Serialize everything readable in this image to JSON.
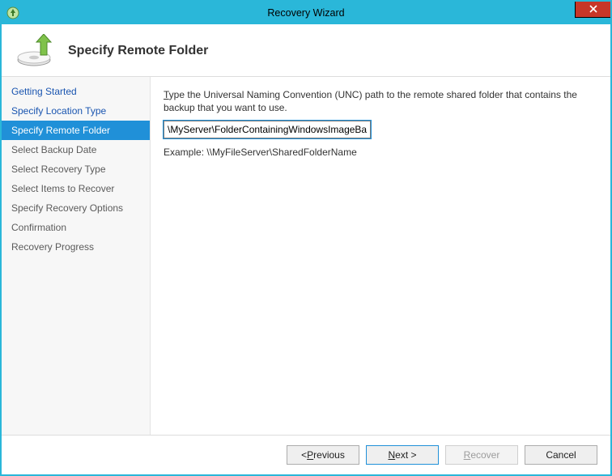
{
  "window": {
    "title": "Recovery Wizard"
  },
  "header": {
    "title": "Specify Remote Folder"
  },
  "sidebar": {
    "items": [
      {
        "label": "Getting Started",
        "state": "completed"
      },
      {
        "label": "Specify Location Type",
        "state": "completed"
      },
      {
        "label": "Specify Remote Folder",
        "state": "current"
      },
      {
        "label": "Select Backup Date",
        "state": "pending"
      },
      {
        "label": "Select Recovery Type",
        "state": "pending"
      },
      {
        "label": "Select Items to Recover",
        "state": "pending"
      },
      {
        "label": "Specify Recovery Options",
        "state": "pending"
      },
      {
        "label": "Confirmation",
        "state": "pending"
      },
      {
        "label": "Recovery Progress",
        "state": "pending"
      }
    ]
  },
  "content": {
    "instruction_hotkey": "T",
    "instruction_rest": "ype the Universal Naming Convention (UNC) path to the remote shared folder that contains the backup that you want to use.",
    "input_value": "\\MyServer\\FolderContainingWindowsImageBackup\\",
    "example": "Example: \\\\MyFileServer\\SharedFolderName"
  },
  "footer": {
    "previous_pre": "< ",
    "previous_hot": "P",
    "previous_post": "revious",
    "next_hot": "N",
    "next_post": "ext >",
    "recover_hot": "R",
    "recover_post": "ecover",
    "cancel": "Cancel"
  }
}
